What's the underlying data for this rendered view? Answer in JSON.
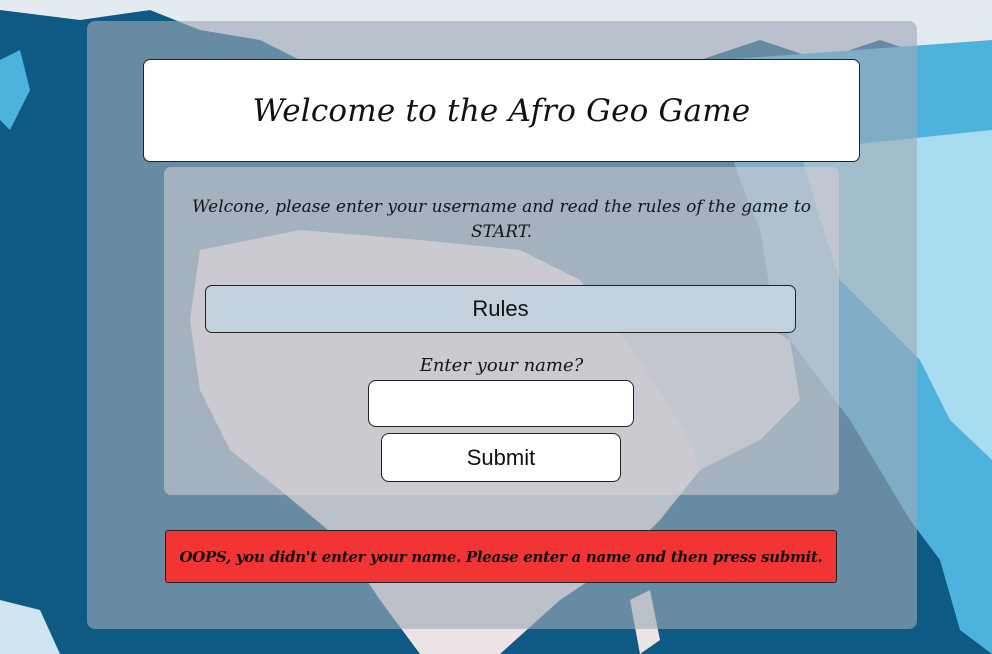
{
  "header": {
    "title": "Welcome to the Afro Geo Game"
  },
  "intro": {
    "text": "Welcone, please enter your username and read the rules of the game to START."
  },
  "rules_button": {
    "label": "Rules"
  },
  "name_form": {
    "label": "Enter your name?",
    "input_value": "",
    "submit_label": "Submit"
  },
  "error": {
    "message": "OOPS, you didn't enter your name. Please enter a name and then press submit."
  },
  "colors": {
    "ocean": "#0e5a84",
    "error_background": "#f23434",
    "rules_button_background": "#c3d1dc"
  }
}
